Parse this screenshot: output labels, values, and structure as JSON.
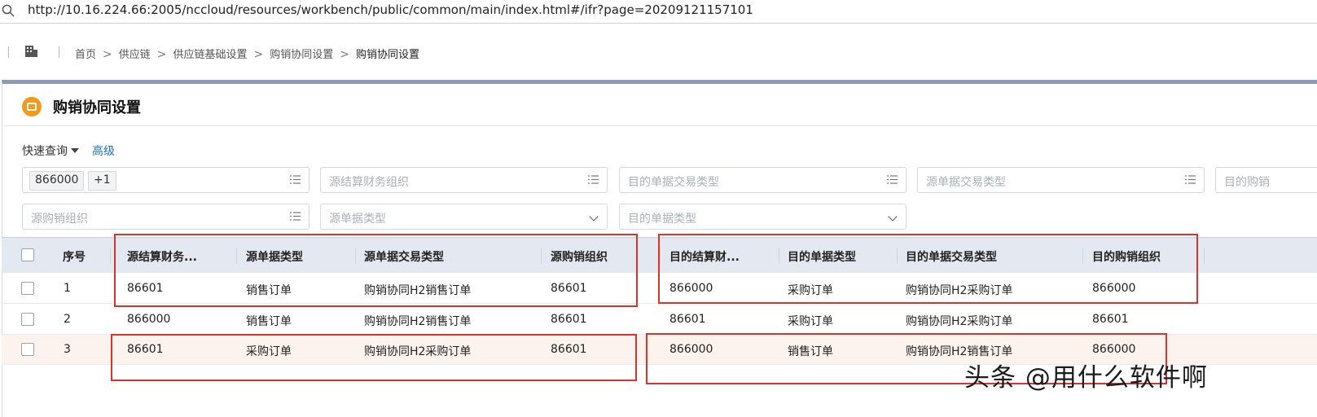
{
  "browser": {
    "url": "http://10.16.224.66:2005/nccloud/resources/workbench/public/common/main/index.html#/ifr?page=20209121157101"
  },
  "breadcrumb": [
    "首页",
    "供应链",
    "供应链基础设置",
    "购销协同设置",
    "购销协同设置"
  ],
  "page": {
    "title": "购销协同设置"
  },
  "query": {
    "quick_label": "快速查询",
    "advanced_label": "高级",
    "selected_tag": "866000",
    "more_tag": "+1",
    "placeholders": {
      "src_finance_org": "源结算财务组织",
      "dst_trans_type": "目的单据交易类型",
      "src_trans_type": "源单据交易类型",
      "dst_org_partial": "目的购销",
      "src_sales_org": "源购销组织",
      "src_bill_type": "源单据类型",
      "dst_bill_type": "目的单据类型"
    }
  },
  "table": {
    "headers": [
      "序号",
      "源结算财务...",
      "源单据类型",
      "源单据交易类型",
      "源购销组织",
      "目的结算财...",
      "目的单据类型",
      "目的单据交易类型",
      "目的购销组织"
    ],
    "rows": [
      [
        "1",
        "86601",
        "销售订单",
        "购销协同H2销售订单",
        "86601",
        "866000",
        "采购订单",
        "购销协同H2采购订单",
        "866000"
      ],
      [
        "2",
        "866000",
        "销售订单",
        "购销协同H2销售订单",
        "86601",
        "86601",
        "采购订单",
        "购销协同H2采购订单",
        "86601"
      ],
      [
        "3",
        "86601",
        "采购订单",
        "购销协同H2采购订单",
        "86601",
        "866000",
        "销售订单",
        "购销协同H2销售订单",
        "866000"
      ]
    ]
  },
  "watermark": "头条 @用什么软件啊",
  "colors": {
    "accent": "#1e6fd0",
    "highlight_box": "#d9342b",
    "app_icon": "#f39a1e",
    "header_bg": "#e4e8f0"
  }
}
